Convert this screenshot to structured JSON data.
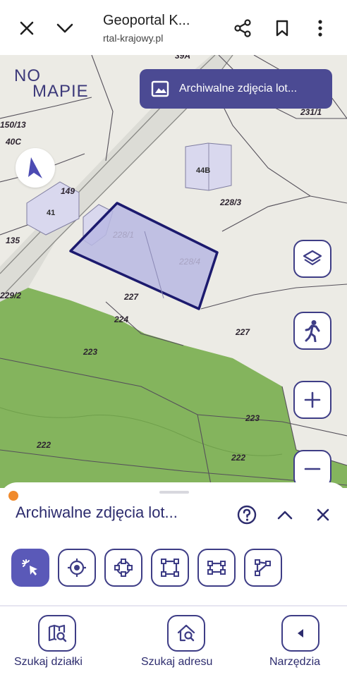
{
  "browser": {
    "title": "Geoportal K...",
    "url": "rtal-krajowy.pl",
    "icons": [
      "close-icon",
      "chevron-down-icon",
      "share-icon",
      "bookmark-icon",
      "more-vert-icon"
    ]
  },
  "map": {
    "logo_line1": "NO",
    "logo_line2": "MAPIE",
    "archive_button": "Archiwalne zdjęcia lot...",
    "parcels": [
      "39A",
      "231/1",
      "150/13",
      "40C",
      "44B",
      "228/3",
      "149",
      "41",
      "135",
      "228/1",
      "228/4",
      "229/2",
      "227",
      "224",
      "227",
      "223",
      "223",
      "222",
      "222"
    ],
    "buildings": [
      "44B",
      "41"
    ],
    "controls": [
      "layers-icon",
      "street-view-icon",
      "zoom-in-icon",
      "zoom-out-icon"
    ],
    "colors": {
      "forest": "#7fb05a",
      "parcel_fill": "#b9b8e3",
      "parcel_stroke": "#1c1a6e",
      "accent": "#3e3d86"
    }
  },
  "sheet": {
    "title": "Archiwalne zdjęcia lot...",
    "actions": [
      "help-icon",
      "chevron-up-icon",
      "close-icon"
    ],
    "tools": [
      "select-tool-icon",
      "point-tool-icon",
      "circle-tool-icon",
      "rectangle-tool-icon",
      "extent-tool-icon",
      "line-tool-icon"
    ]
  },
  "nav": {
    "parcel_search": "Szukaj działki",
    "address_search": "Szukaj adresu",
    "tools": "Narzędzia"
  }
}
